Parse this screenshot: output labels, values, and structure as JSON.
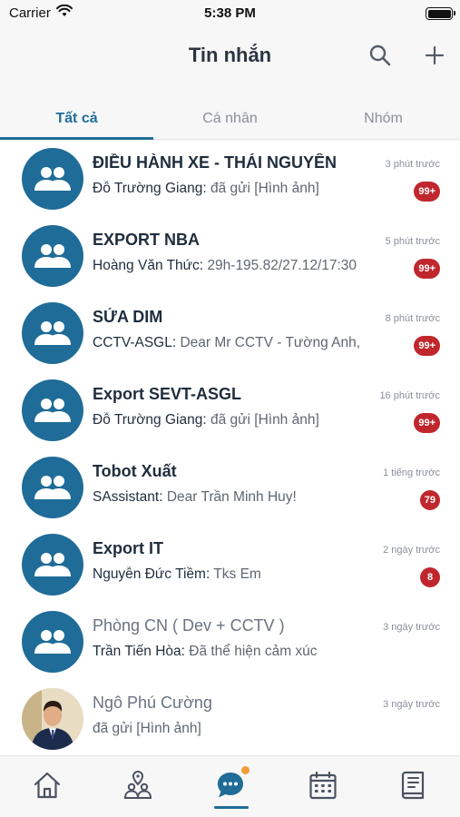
{
  "status_bar": {
    "carrier": "Carrier",
    "time": "5:38 PM"
  },
  "header": {
    "title": "Tin nhắn"
  },
  "tabs": [
    {
      "label": "Tất cả",
      "active": true
    },
    {
      "label": "Cá nhân",
      "active": false
    },
    {
      "label": "Nhóm",
      "active": false
    }
  ],
  "conversations": [
    {
      "name": "ĐIỀU HÀNH XE - THÁI NGUYÊN",
      "sender": "Đỗ Trường Giang:",
      "message": " đã gửi [Hình ảnh]",
      "time": "3 phút trước",
      "unread": "99+",
      "type": "group",
      "read": false
    },
    {
      "name": "EXPORT NBA",
      "sender": "Hoàng Văn Thức:",
      "message": " 29h-195.82/27.12/17:30",
      "time": "5 phút trước",
      "unread": "99+",
      "type": "group",
      "read": false
    },
    {
      "name": "SỬA DIM",
      "sender": "CCTV-ASGL:",
      "message": " Dear Mr CCTV - Tường Anh,",
      "time": "8 phút trước",
      "unread": "99+",
      "type": "group",
      "read": false
    },
    {
      "name": "Export SEVT-ASGL",
      "sender": "Đỗ Trường Giang:",
      "message": " đã gửi [Hình ảnh]",
      "time": "16 phút trước",
      "unread": "99+",
      "type": "group",
      "read": false
    },
    {
      "name": "Tobot Xuất",
      "sender": "SAssistant:",
      "message": " Dear Trần Minh Huy!",
      "time": "1 tiếng trước",
      "unread": "79",
      "type": "group",
      "read": false
    },
    {
      "name": "Export IT",
      "sender": "Nguyễn Đức Tiềm:",
      "message": " Tks Em",
      "time": "2 ngày trước",
      "unread": "8",
      "type": "group",
      "read": false
    },
    {
      "name": "Phòng CN ( Dev + CCTV )",
      "sender": "Trần Tiến Hòa:",
      "message": " Đã thể hiện cảm xúc",
      "time": "3 ngày trước",
      "unread": "",
      "type": "group",
      "read": true
    },
    {
      "name": "Ngô Phú Cường",
      "sender": "",
      "message": "đã gửi [Hình ảnh]",
      "time": "3 ngày trước",
      "unread": "",
      "type": "person",
      "read": true
    }
  ],
  "bottom_nav": [
    {
      "icon": "home-icon",
      "active": false
    },
    {
      "icon": "location-people-icon",
      "active": false
    },
    {
      "icon": "chat-icon",
      "active": true
    },
    {
      "icon": "calendar-icon",
      "active": false
    },
    {
      "icon": "book-icon",
      "active": false
    }
  ],
  "colors": {
    "primary": "#1f6c98",
    "badge": "#c0272d",
    "notification_dot": "#f29c38"
  }
}
